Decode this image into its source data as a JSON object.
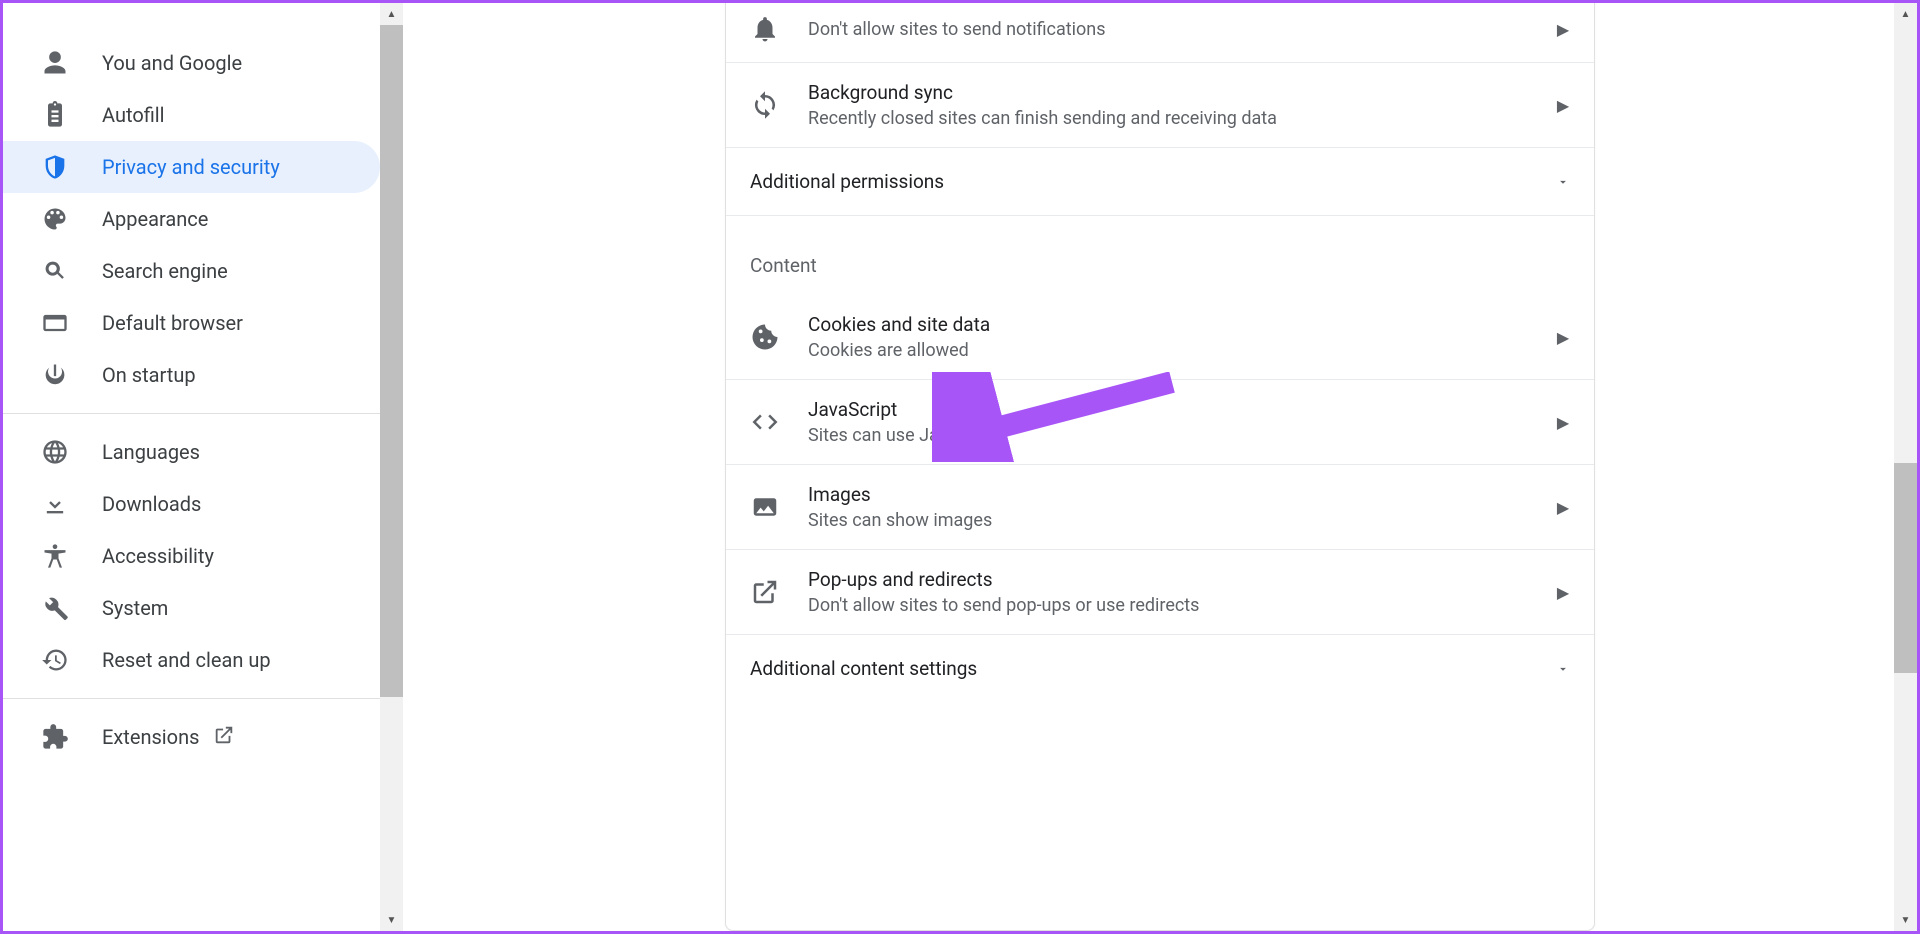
{
  "sidebar": {
    "items": [
      {
        "id": "you-and-google",
        "label": "You and Google",
        "icon": "person"
      },
      {
        "id": "autofill",
        "label": "Autofill",
        "icon": "clipboard"
      },
      {
        "id": "privacy-security",
        "label": "Privacy and security",
        "icon": "shield",
        "active": true
      },
      {
        "id": "appearance",
        "label": "Appearance",
        "icon": "palette"
      },
      {
        "id": "search-engine",
        "label": "Search engine",
        "icon": "search"
      },
      {
        "id": "default-browser",
        "label": "Default browser",
        "icon": "browser"
      },
      {
        "id": "on-startup",
        "label": "On startup",
        "icon": "power"
      }
    ],
    "advanced": [
      {
        "id": "languages",
        "label": "Languages",
        "icon": "globe"
      },
      {
        "id": "downloads",
        "label": "Downloads",
        "icon": "download"
      },
      {
        "id": "accessibility",
        "label": "Accessibility",
        "icon": "accessibility"
      },
      {
        "id": "system",
        "label": "System",
        "icon": "wrench"
      },
      {
        "id": "reset",
        "label": "Reset and clean up",
        "icon": "restore"
      }
    ],
    "extensions_label": "Extensions"
  },
  "main": {
    "rows_top": [
      {
        "id": "notifications",
        "title": "",
        "desc": "Don't allow sites to send notifications",
        "icon": "bell"
      },
      {
        "id": "bgsync",
        "title": "Background sync",
        "desc": "Recently closed sites can finish sending and receiving data",
        "icon": "sync"
      }
    ],
    "additional_permissions": "Additional permissions",
    "content_heading": "Content",
    "content_rows": [
      {
        "id": "cookies",
        "title": "Cookies and site data",
        "desc": "Cookies are allowed",
        "icon": "cookie"
      },
      {
        "id": "javascript",
        "title": "JavaScript",
        "desc": "Sites can use Javascript",
        "icon": "code"
      },
      {
        "id": "images",
        "title": "Images",
        "desc": "Sites can show images",
        "icon": "image"
      },
      {
        "id": "popups",
        "title": "Pop-ups and redirects",
        "desc": "Don't allow sites to send pop-ups or use redirects",
        "icon": "openext"
      }
    ],
    "additional_content": "Additional content settings"
  },
  "annotation_color": "#a855f7"
}
